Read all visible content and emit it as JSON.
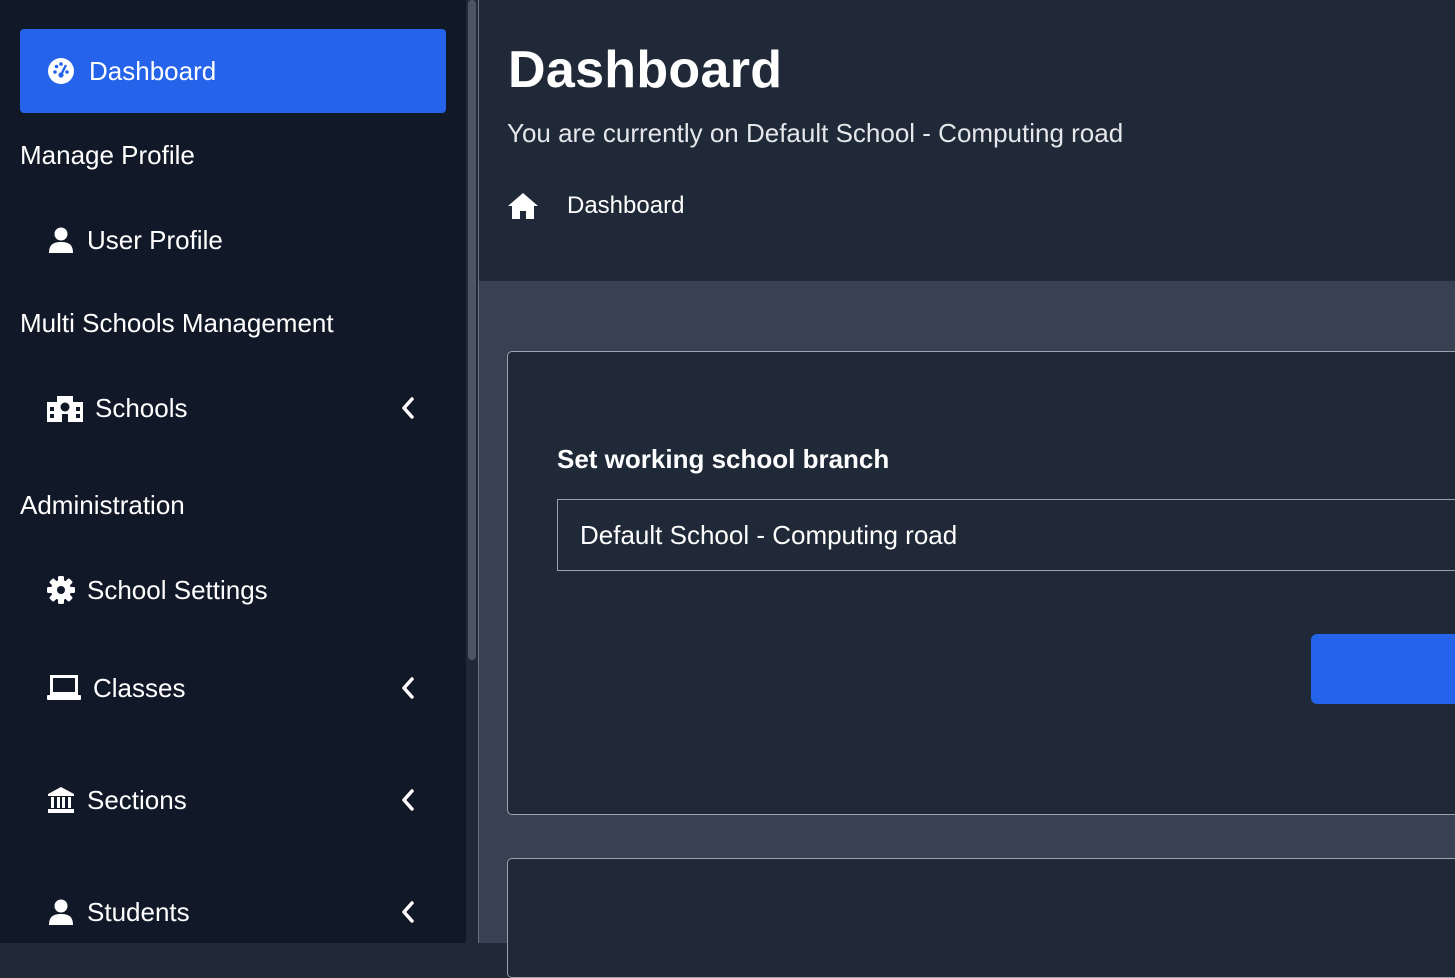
{
  "sidebar": {
    "active_item": {
      "label": "Dashboard",
      "icon": "gauge-icon"
    },
    "headings": {
      "manage_profile": "Manage Profile",
      "multi_schools": "Multi Schools Management",
      "administration": "Administration"
    },
    "items": {
      "user_profile": {
        "label": "User Profile",
        "icon": "user-icon"
      },
      "schools": {
        "label": "Schools",
        "icon": "school-icon"
      },
      "school_settings": {
        "label": "School Settings",
        "icon": "gear-icon"
      },
      "classes": {
        "label": "Classes",
        "icon": "laptop-icon"
      },
      "sections": {
        "label": "Sections",
        "icon": "bank-icon"
      },
      "students": {
        "label": "Students",
        "icon": "user-icon"
      }
    }
  },
  "header": {
    "title": "Dashboard",
    "subtitle": "You are currently on Default School - Computing road",
    "breadcrumb": {
      "label": "Dashboard",
      "icon": "home-icon"
    }
  },
  "branch_form": {
    "label": "Set working school branch",
    "selected_value": "Default School - Computing road"
  },
  "colors": {
    "accent": "#2563eb",
    "sidebar_bg": "#111827",
    "panel_bg": "#1f2937",
    "content_bg": "#374151"
  }
}
